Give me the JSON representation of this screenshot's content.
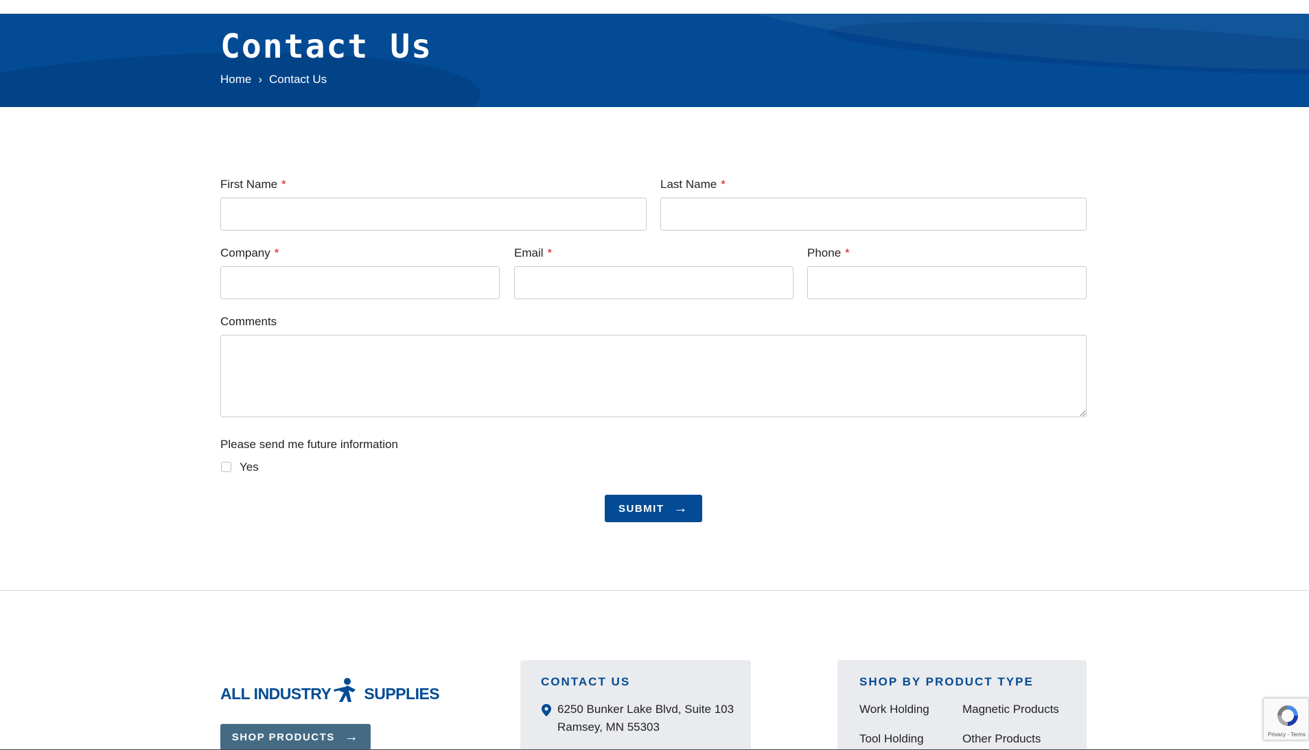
{
  "hero": {
    "title": "Contact Us",
    "breadcrumb": [
      {
        "label": "Home"
      },
      {
        "label": "Contact Us"
      }
    ],
    "background_color": "#034b94"
  },
  "form": {
    "first_name": {
      "label": "First Name",
      "required_mark": "*",
      "value": ""
    },
    "last_name": {
      "label": "Last Name",
      "required_mark": "*",
      "value": ""
    },
    "company": {
      "label": "Company",
      "required_mark": "*",
      "value": ""
    },
    "email": {
      "label": "Email",
      "required_mark": "*",
      "value": ""
    },
    "phone": {
      "label": "Phone",
      "required_mark": "*",
      "value": ""
    },
    "comments": {
      "label": "Comments",
      "value": ""
    },
    "future_info": {
      "label": "Please send me future information",
      "option_label": "Yes",
      "checked": false
    },
    "submit_label": "SUBMIT"
  },
  "footer": {
    "logo": {
      "left_text": "ALL INDUSTRY",
      "right_text": "SUPPLIES"
    },
    "shop_button_label": "SHOP PRODUCTS",
    "contact": {
      "title": "CONTACT US",
      "address_line1": "6250 Bunker Lake Blvd, Suite 103",
      "address_line2": "Ramsey, MN 55303",
      "icon": "map-pin-icon"
    },
    "shop_by_type": {
      "title": "SHOP BY PRODUCT TYPE",
      "links": [
        "Work Holding",
        "Magnetic Products",
        "Tool Holding",
        "Other Products"
      ]
    }
  },
  "recaptcha": {
    "terms": "Privacy - Terms"
  },
  "colors": {
    "brand_blue": "#034b94",
    "required_red": "#dd1111",
    "card_bg": "#e9ebee",
    "shop_button": "#456b84"
  }
}
